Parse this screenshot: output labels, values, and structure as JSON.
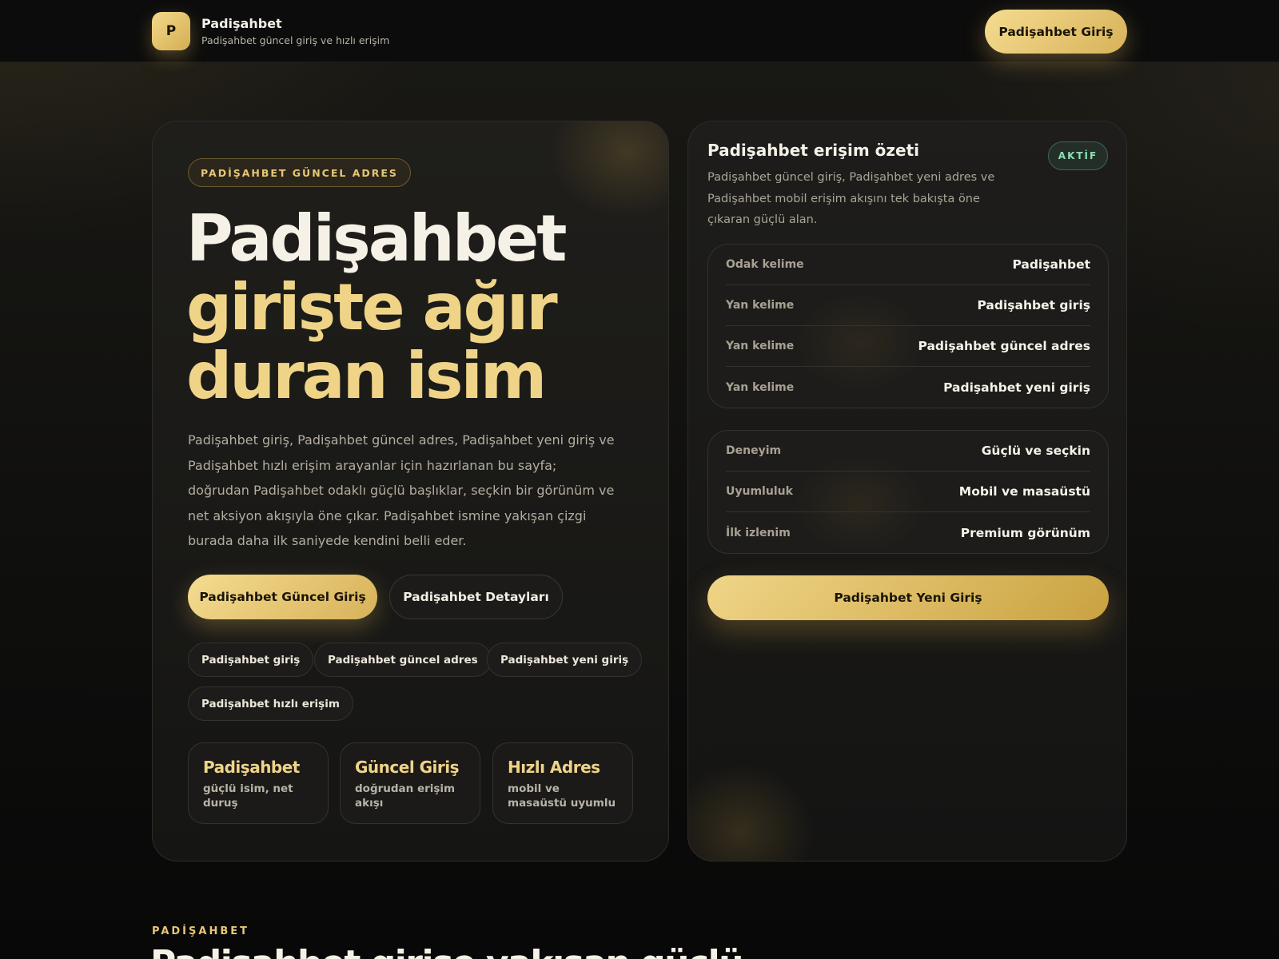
{
  "header": {
    "logo_letter": "P",
    "brand_name": "Padişahbet",
    "brand_sub": "Padişahbet güncel giriş ve hızlı erişim",
    "cta_label": "Padişahbet Giriş"
  },
  "hero": {
    "eyebrow": "PADİŞAHBET GÜNCEL ADRES",
    "title_line1": "Padişahbet",
    "title_line2": "girişte ağır",
    "title_line3": "duran isim",
    "description": "Padişahbet giriş, Padişahbet güncel adres, Padişahbet yeni giriş ve Padişahbet hızlı erişim arayanlar için hazırlanan bu sayfa; doğrudan Padişahbet odaklı güçlü başlıklar, seçkin bir görünüm ve net aksiyon akışıyla öne çıkar. Padişahbet ismine yakışan çizgi burada daha ilk saniyede kendini belli eder.",
    "primary_button": "Padişahbet Güncel Giriş",
    "secondary_button": "Padişahbet Detayları",
    "tags": [
      "Padişahbet giriş",
      "Padişahbet güncel adres",
      "Padişahbet yeni giriş",
      "Padişahbet hızlı erişim"
    ],
    "mini_cards": [
      {
        "title": "Padişahbet",
        "sub": "güçlü isim, net duruş"
      },
      {
        "title": "Güncel Giriş",
        "sub": "doğrudan erişim akışı"
      },
      {
        "title": "Hızlı Adres",
        "sub": "mobil ve masaüstü uyumlu"
      }
    ]
  },
  "summary": {
    "title": "Padişahbet erişim özeti",
    "status": "AKTİF",
    "description": "Padişahbet güncel giriş, Padişahbet yeni adres ve Padişahbet mobil erişim akışını tek bakışta öne çıkaran güçlü alan.",
    "keywords": [
      {
        "key": "Odak kelime",
        "value": "Padişahbet"
      },
      {
        "key": "Yan kelime",
        "value": "Padişahbet giriş"
      },
      {
        "key": "Yan kelime",
        "value": "Padişahbet güncel adres"
      },
      {
        "key": "Yan kelime",
        "value": "Padişahbet yeni giriş"
      }
    ],
    "features": [
      {
        "key": "Deneyim",
        "value": "Güçlü ve seçkin"
      },
      {
        "key": "Uyumluluk",
        "value": "Mobil ve masaüstü"
      },
      {
        "key": "İlk izlenim",
        "value": "Premium görünüm"
      }
    ],
    "cta_label": "Padişahbet Yeni Giriş"
  },
  "section": {
    "eyebrow": "PADİŞAHBET",
    "title": "Padişahbet girişe yakışan güçlü"
  },
  "colors": {
    "accent_gold": "#e6c775",
    "background": "#0b0b0b",
    "status_green": "#8fdfb3"
  }
}
